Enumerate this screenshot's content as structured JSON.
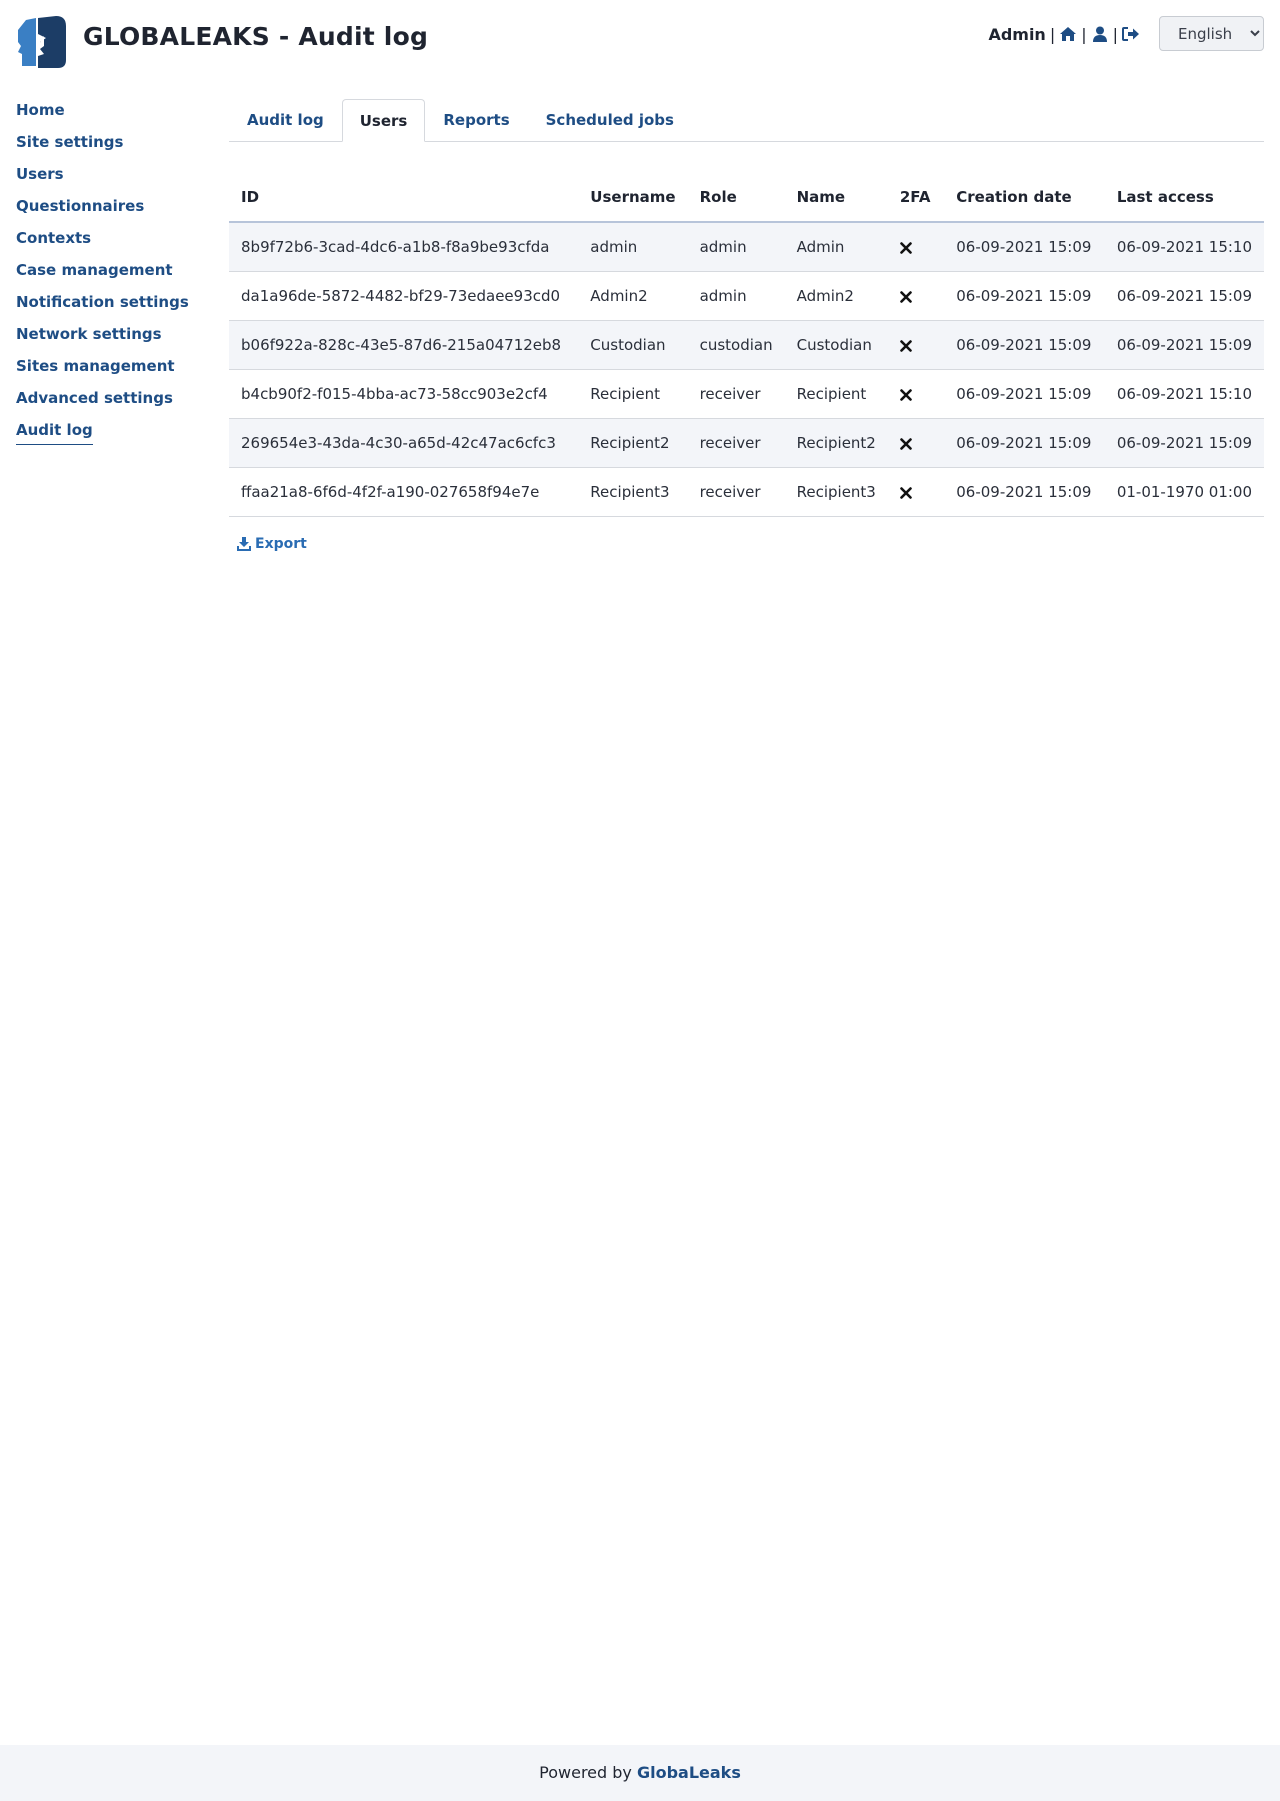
{
  "header": {
    "title": "GLOBALEAKS - Audit log",
    "user_name": "Admin",
    "separator": "|",
    "icons": [
      "home-icon",
      "user-icon",
      "sign-out-icon"
    ],
    "language": {
      "selected": "English",
      "options": [
        "English"
      ]
    }
  },
  "sidebar": {
    "items": [
      {
        "label": "Home",
        "active": false
      },
      {
        "label": "Site settings",
        "active": false
      },
      {
        "label": "Users",
        "active": false
      },
      {
        "label": "Questionnaires",
        "active": false
      },
      {
        "label": "Contexts",
        "active": false
      },
      {
        "label": "Case management",
        "active": false
      },
      {
        "label": "Notification settings",
        "active": false
      },
      {
        "label": "Network settings",
        "active": false
      },
      {
        "label": "Sites management",
        "active": false
      },
      {
        "label": "Advanced settings",
        "active": false
      },
      {
        "label": "Audit log",
        "active": true
      }
    ]
  },
  "tabs": [
    {
      "label": "Audit log",
      "active": false
    },
    {
      "label": "Users",
      "active": true
    },
    {
      "label": "Reports",
      "active": false
    },
    {
      "label": "Scheduled jobs",
      "active": false
    }
  ],
  "table": {
    "columns": [
      "ID",
      "Username",
      "Role",
      "Name",
      "2FA",
      "Creation date",
      "Last access"
    ],
    "rows": [
      {
        "id": "8b9f72b6-3cad-4dc6-a1b8-f8a9be93cfda",
        "username": "admin",
        "role": "admin",
        "name": "Admin",
        "two_fa": "times-icon",
        "creation_date": "06-09-2021 15:09",
        "last_access": "06-09-2021 15:10"
      },
      {
        "id": "da1a96de-5872-4482-bf29-73edaee93cd0",
        "username": "Admin2",
        "role": "admin",
        "name": "Admin2",
        "two_fa": "times-icon",
        "creation_date": "06-09-2021 15:09",
        "last_access": "06-09-2021 15:09"
      },
      {
        "id": "b06f922a-828c-43e5-87d6-215a04712eb8",
        "username": "Custodian",
        "role": "custodian",
        "name": "Custodian",
        "two_fa": "times-icon",
        "creation_date": "06-09-2021 15:09",
        "last_access": "06-09-2021 15:09"
      },
      {
        "id": "b4cb90f2-f015-4bba-ac73-58cc903e2cf4",
        "username": "Recipient",
        "role": "receiver",
        "name": "Recipient",
        "two_fa": "times-icon",
        "creation_date": "06-09-2021 15:09",
        "last_access": "06-09-2021 15:10"
      },
      {
        "id": "269654e3-43da-4c30-a65d-42c47ac6cfc3",
        "username": "Recipient2",
        "role": "receiver",
        "name": "Recipient2",
        "two_fa": "times-icon",
        "creation_date": "06-09-2021 15:09",
        "last_access": "06-09-2021 15:09"
      },
      {
        "id": "ffaa21a8-6f6d-4f2f-a190-027658f94e7e",
        "username": "Recipient3",
        "role": "receiver",
        "name": "Recipient3",
        "two_fa": "times-icon",
        "creation_date": "06-09-2021 15:09",
        "last_access": "01-01-1970 01:00"
      }
    ]
  },
  "export": {
    "label": "Export",
    "icon": "download-icon"
  },
  "footer": {
    "prefix": "Powered by",
    "brand": "GlobaLeaks"
  },
  "colors": {
    "link": "#1e4d84",
    "logo_light": "#3a7fc4",
    "logo_dark": "#1c3d66",
    "row_stripe": "#f3f5f9",
    "footer_bg": "#f3f5f9"
  }
}
